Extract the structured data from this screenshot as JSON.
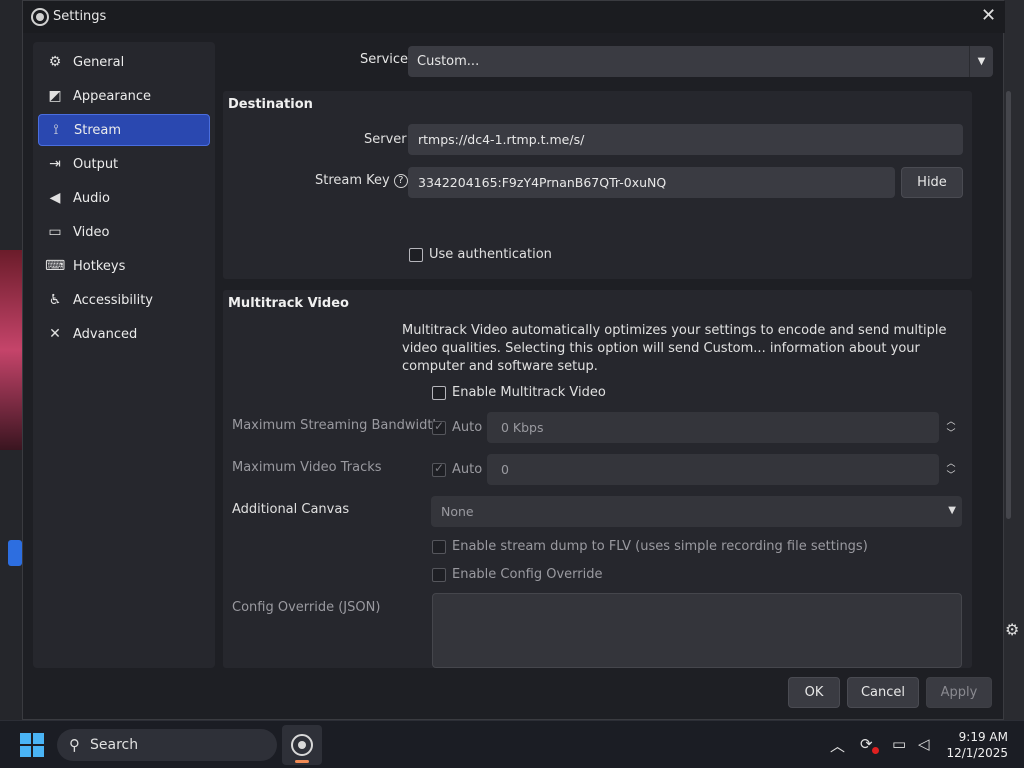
{
  "dialog": {
    "title": "Settings"
  },
  "sidebar": {
    "items": [
      {
        "label": "General",
        "icon": "gear-icon",
        "glyph": "⚙"
      },
      {
        "label": "Appearance",
        "icon": "appearance-icon",
        "glyph": "◩"
      },
      {
        "label": "Stream",
        "icon": "antenna-icon",
        "glyph": "⟟"
      },
      {
        "label": "Output",
        "icon": "output-icon",
        "glyph": "⇥"
      },
      {
        "label": "Audio",
        "icon": "speaker-icon",
        "glyph": "◀"
      },
      {
        "label": "Video",
        "icon": "monitor-icon",
        "glyph": "▭"
      },
      {
        "label": "Hotkeys",
        "icon": "keyboard-icon",
        "glyph": "⌨"
      },
      {
        "label": "Accessibility",
        "icon": "accessibility-icon",
        "glyph": "♿"
      },
      {
        "label": "Advanced",
        "icon": "tools-icon",
        "glyph": "✕"
      }
    ],
    "active": "Stream"
  },
  "stream": {
    "service_label": "Service",
    "service_value": "Custom...",
    "destination": {
      "title": "Destination",
      "server_label": "Server",
      "server_value": "rtmps://dc4-1.rtmp.t.me/s/",
      "stream_key_label": "Stream Key",
      "stream_key_value": "3342204165:F9zY4PrnanB67QTr-0xuNQ",
      "hide_button": "Hide",
      "use_auth_label": "Use authentication"
    },
    "multitrack": {
      "title": "Multitrack Video",
      "description": "Multitrack Video automatically optimizes your settings to encode and send multiple video qualities. Selecting this option will send Custom... information about your computer and software setup.",
      "enable_label": "Enable Multitrack Video",
      "max_bandwidth_label": "Maximum Streaming Bandwidth",
      "max_bandwidth_auto": "Auto",
      "max_bandwidth_value": "0 Kbps",
      "max_tracks_label": "Maximum Video Tracks",
      "max_tracks_auto": "Auto",
      "max_tracks_value": "0",
      "additional_canvas_label": "Additional Canvas",
      "additional_canvas_value": "None",
      "stream_dump_label": "Enable stream dump to FLV (uses simple recording file settings)",
      "config_override_label": "Enable Config Override",
      "config_json_label": "Config Override (JSON)"
    }
  },
  "footer": {
    "ok": "OK",
    "cancel": "Cancel",
    "apply": "Apply"
  },
  "taskbar": {
    "search_label": "Search",
    "time": "9:19 AM",
    "date": "12/1/2025"
  }
}
